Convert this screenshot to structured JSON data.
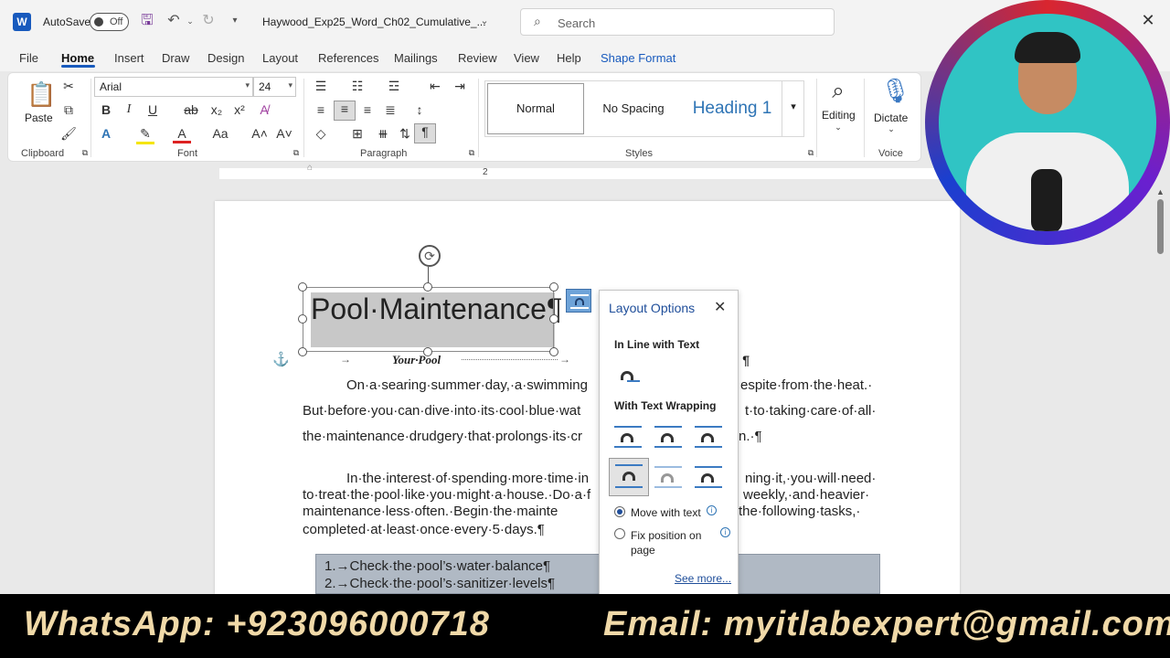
{
  "titlebar": {
    "autosave_label": "AutoSave",
    "autosave_state": "Off",
    "doc_title": "Haywood_Exp25_Word_Ch02_Cumulative_...",
    "search_placeholder": "Search"
  },
  "menu": {
    "tabs": [
      "File",
      "Home",
      "Insert",
      "Draw",
      "Design",
      "Layout",
      "References",
      "Mailings",
      "Review",
      "View",
      "Help",
      "Shape Format"
    ],
    "active": "Home"
  },
  "ribbon": {
    "clipboard": {
      "paste_label": "Paste",
      "group_label": "Clipboard"
    },
    "font": {
      "font_name": "Arial",
      "font_size": "24",
      "group_label": "Font"
    },
    "paragraph": {
      "group_label": "Paragraph"
    },
    "styles": {
      "items": [
        "Normal",
        "No Spacing",
        "Heading 1"
      ],
      "group_label": "Styles"
    },
    "editing": {
      "label": "Editing"
    },
    "voice": {
      "dictate_label": "Dictate",
      "group_label": "Voice"
    }
  },
  "ruler": {
    "mark": "2"
  },
  "document": {
    "title": "Pool·Maintenance¶",
    "subtitle": "Your·Pool",
    "subtitle_tail": "¶",
    "para1": [
      "On·a·searing·summer·day,·a·swimming",
      "espite·from·the·heat.·",
      "But·before·you·can·dive·into·its·cool·blue·wat",
      "t·to·taking·care·of·all·",
      "the·maintenance·drudgery·that·prolongs·its·cr",
      "n.·¶"
    ],
    "para2": [
      "In·the·interest·of·spending·more·time·in",
      "ning·it,·you·will·need·",
      "to·treat·the·pool·like·you·might·a·house.·Do·a·f",
      "weekly,·and·heavier·",
      "maintenance·less·often.·Begin·the·mainte",
      "the·following·tasks,·",
      "completed·at·least·once·every·5·days.¶"
    ],
    "list": [
      "1.→Check·the·pool’s·water·balance¶",
      "2.→Check·the·pool’s·sanitizer·levels¶"
    ]
  },
  "layout_options": {
    "title": "Layout Options",
    "inline_heading": "In Line with Text",
    "wrapping_heading": "With Text Wrapping",
    "move_with_text": "Move with text",
    "fix_position": "Fix position on page",
    "see_more": "See more..."
  },
  "banner": {
    "whatsapp": "WhatsApp: +923096000718",
    "email": "Email: myitlabexpert@gmail.com"
  }
}
